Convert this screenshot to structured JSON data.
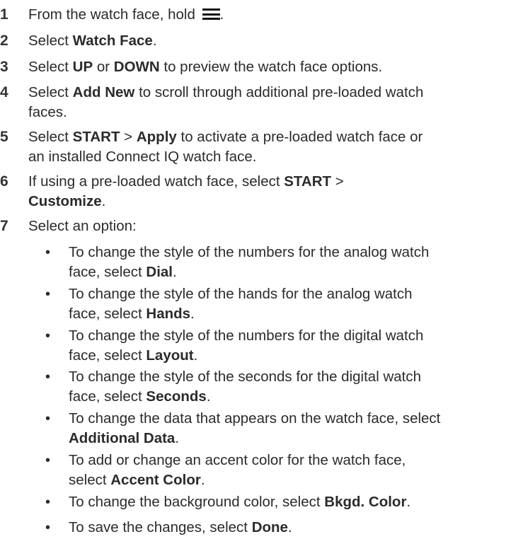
{
  "steps": [
    {
      "num": "1",
      "parts": [
        "From the watch face, hold ",
        "."
      ],
      "icon": "menu-icon"
    },
    {
      "num": "2",
      "parts": [
        "Select ",
        "Watch Face",
        "."
      ]
    },
    {
      "num": "3",
      "parts": [
        "Select ",
        "UP",
        " or ",
        "DOWN",
        " to preview the watch face options."
      ]
    },
    {
      "num": "4",
      "parts": [
        "Select ",
        "Add New",
        " to scroll through additional pre-loaded watch",
        "faces."
      ]
    },
    {
      "num": "5",
      "parts": [
        "Select ",
        "START",
        " > ",
        "Apply",
        " to activate a pre-loaded watch face or",
        "an installed Connect IQ watch face."
      ]
    },
    {
      "num": "6",
      "parts": [
        "If using a pre-loaded watch face, select ",
        "START",
        " >",
        "Customize",
        "."
      ]
    },
    {
      "num": "7",
      "parts": [
        "Select an option:"
      ]
    }
  ],
  "bullets": [
    {
      "lines": [
        "To change the style of the numbers for the analog watch",
        "face, select "
      ],
      "bold": "Dial",
      "end": "."
    },
    {
      "lines": [
        "To change the style of the hands for the analog watch",
        "face, select "
      ],
      "bold": "Hands",
      "end": "."
    },
    {
      "lines": [
        "To change the style of the numbers for the digital watch",
        "face, select "
      ],
      "bold": "Layout",
      "end": "."
    },
    {
      "lines": [
        "To change the style of the seconds for the digital watch",
        "face, select "
      ],
      "bold": "Seconds",
      "end": "."
    },
    {
      "lines": [
        "To change the data that appears on the watch face, select",
        ""
      ],
      "bold": "Additional Data",
      "end": "."
    },
    {
      "lines": [
        "To add or change an accent color for the watch face,",
        "select "
      ],
      "bold": "Accent Color",
      "end": "."
    },
    {
      "lines": [
        "To change the background color, select "
      ],
      "bold": "Bkgd. Color",
      "end": "."
    },
    {
      "lines": [
        "To save the changes, select "
      ],
      "bold": "Done",
      "end": "."
    }
  ],
  "bullet_glyph": "•"
}
